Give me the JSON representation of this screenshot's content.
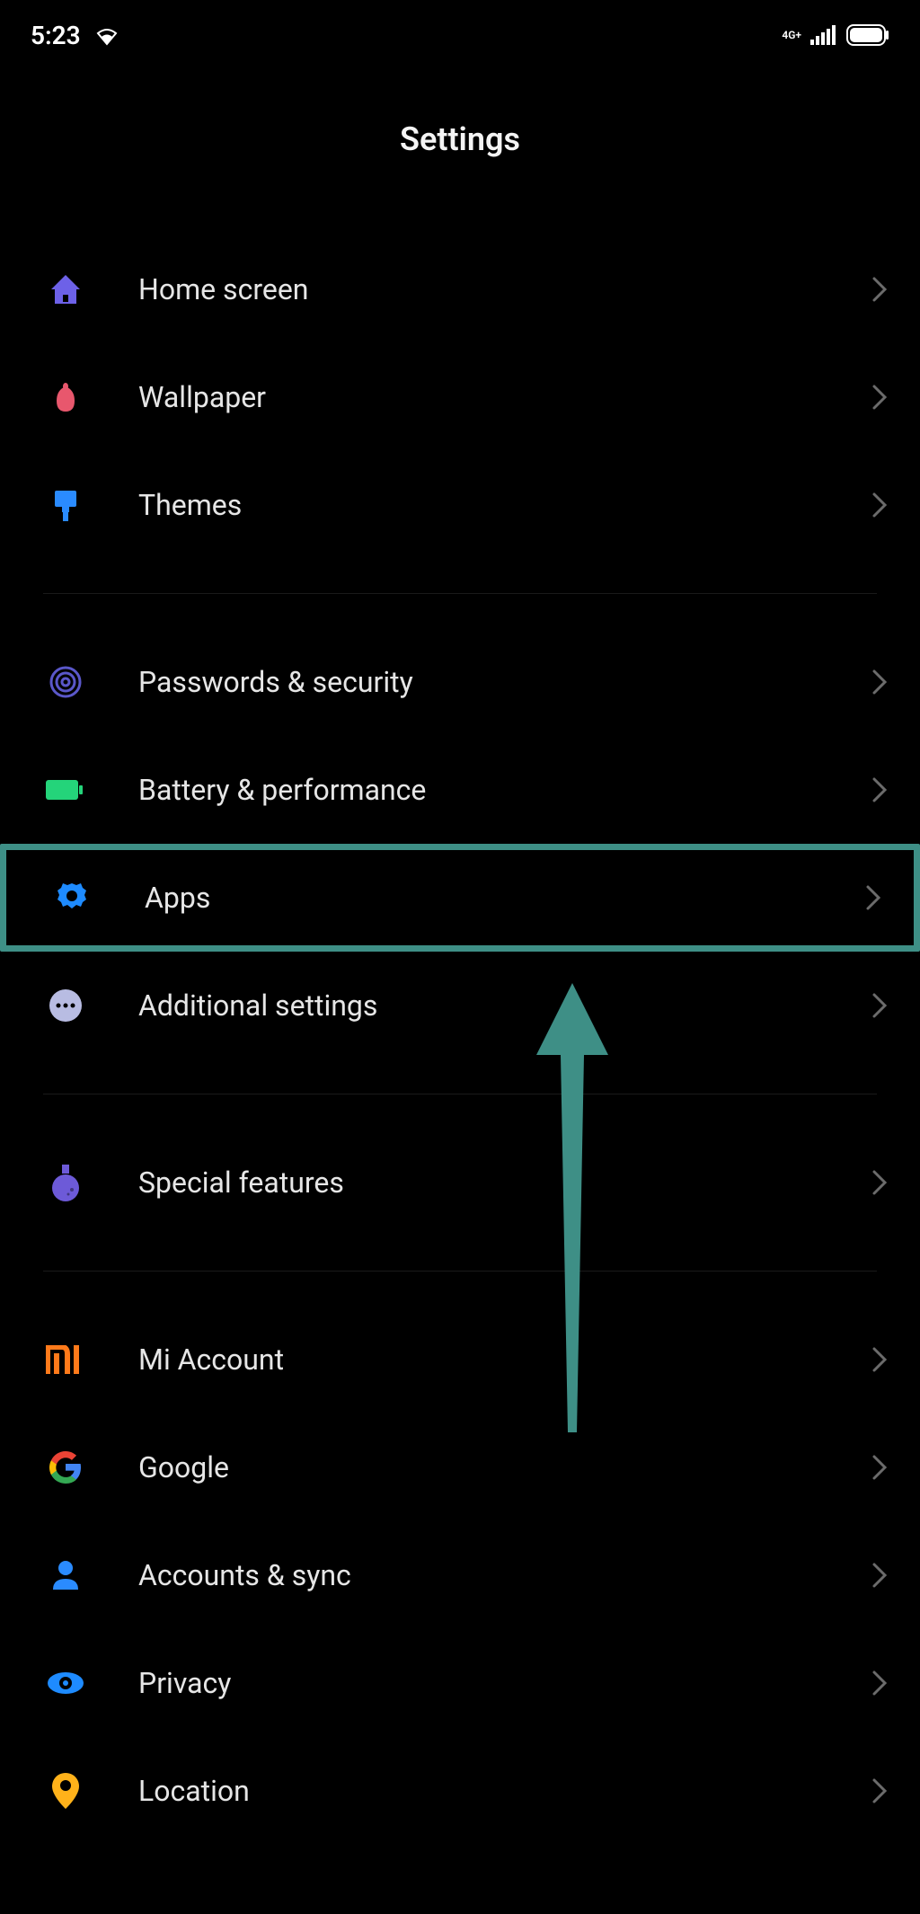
{
  "statusbar": {
    "time": "5:23",
    "network_label": "4G+"
  },
  "header": {
    "title": "Settings"
  },
  "groups": [
    {
      "items": [
        {
          "id": "home-screen",
          "label": "Home screen",
          "icon_color": "#6d61e8"
        },
        {
          "id": "wallpaper",
          "label": "Wallpaper",
          "icon_color": "#e8576d"
        },
        {
          "id": "themes",
          "label": "Themes",
          "icon_color": "#2a8bff"
        }
      ]
    },
    {
      "items": [
        {
          "id": "passwords-security",
          "label": "Passwords & security",
          "icon_color": "#5a57c9"
        },
        {
          "id": "battery-performance",
          "label": "Battery & performance",
          "icon_color": "#24d47a"
        },
        {
          "id": "apps",
          "label": "Apps",
          "icon_color": "#1e8bff",
          "highlighted": true
        },
        {
          "id": "additional-settings",
          "label": "Additional settings",
          "icon_color": "#b8bce2"
        }
      ]
    },
    {
      "items": [
        {
          "id": "special-features",
          "label": "Special features",
          "icon_color": "#6d5ad8"
        }
      ]
    },
    {
      "items": [
        {
          "id": "mi-account",
          "label": "Mi Account",
          "icon_color": "#ff7a1a"
        },
        {
          "id": "google",
          "label": "Google",
          "icon_color": "#4285F4"
        },
        {
          "id": "accounts-sync",
          "label": "Accounts & sync",
          "icon_color": "#2a8bff"
        },
        {
          "id": "privacy",
          "label": "Privacy",
          "icon_color": "#1e8bff"
        },
        {
          "id": "location",
          "label": "Location",
          "icon_color": "#ffb21a"
        }
      ]
    }
  ],
  "annotation": {
    "arrow_color": "#3e8f86",
    "points_to": "apps"
  }
}
